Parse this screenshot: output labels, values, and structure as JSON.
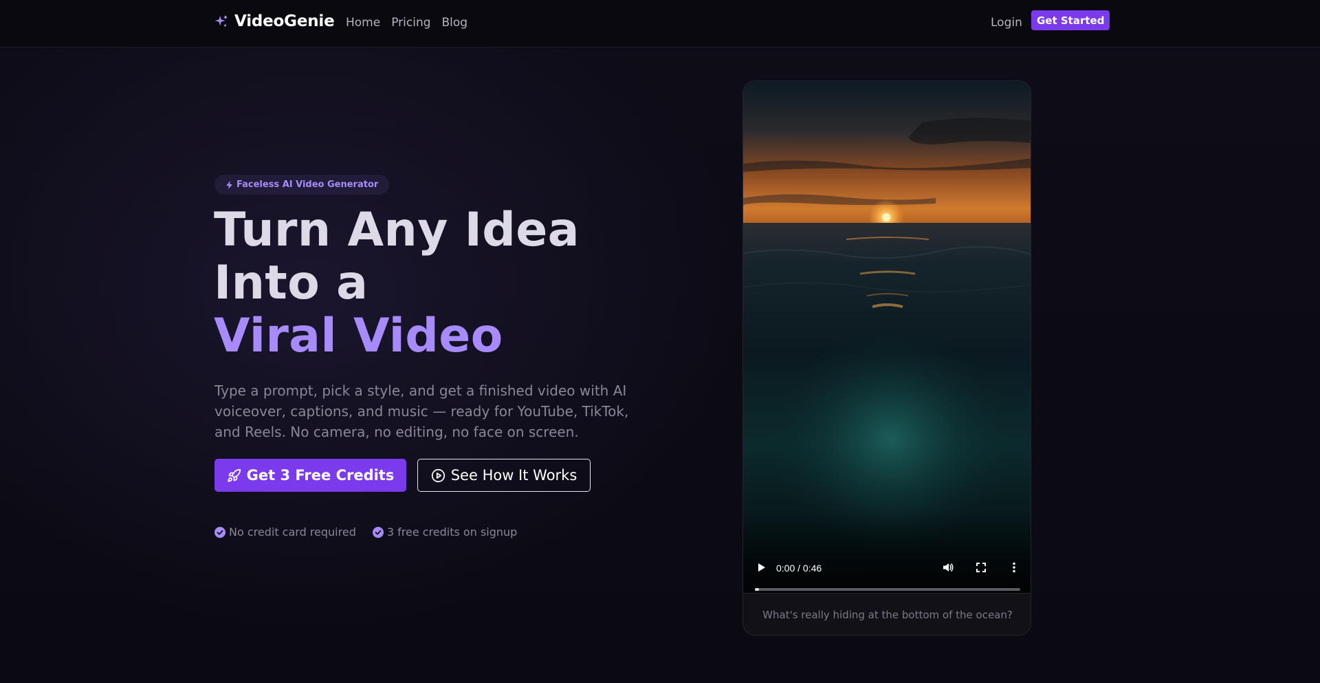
{
  "nav": {
    "brand": "VideoGenie",
    "links": [
      "Home",
      "Pricing",
      "Blog"
    ],
    "login": "Login",
    "cta": "Get Started"
  },
  "hero": {
    "badge": "Faceless AI Video Generator",
    "headline_line1": "Turn Any Idea",
    "headline_line2": "Into a",
    "headline_accent": "Viral Video",
    "subcopy": "Type a prompt, pick a style, and get a finished video with AI voiceover, captions, and music — ready for YouTube, TikTok, and Reels. No camera, no editing, no face on screen.",
    "primary_cta": "Get 3 Free Credits",
    "secondary_cta": "See How It Works",
    "perks": [
      "No credit card required",
      "3 free credits on signup"
    ]
  },
  "video": {
    "time": "0:00 / 0:46",
    "progress": 0.0,
    "caption": "What's really hiding at the bottom of the ocean?"
  },
  "colors": {
    "accent": "#7c3aed",
    "accent_light": "#a78bfa",
    "background": "#0b0a12"
  },
  "icons": {
    "brand": "sparkles-icon",
    "badge": "lightning-icon",
    "primary_cta": "rocket-icon",
    "secondary_cta": "play-circle-icon",
    "perk": "check-circle-icon"
  }
}
